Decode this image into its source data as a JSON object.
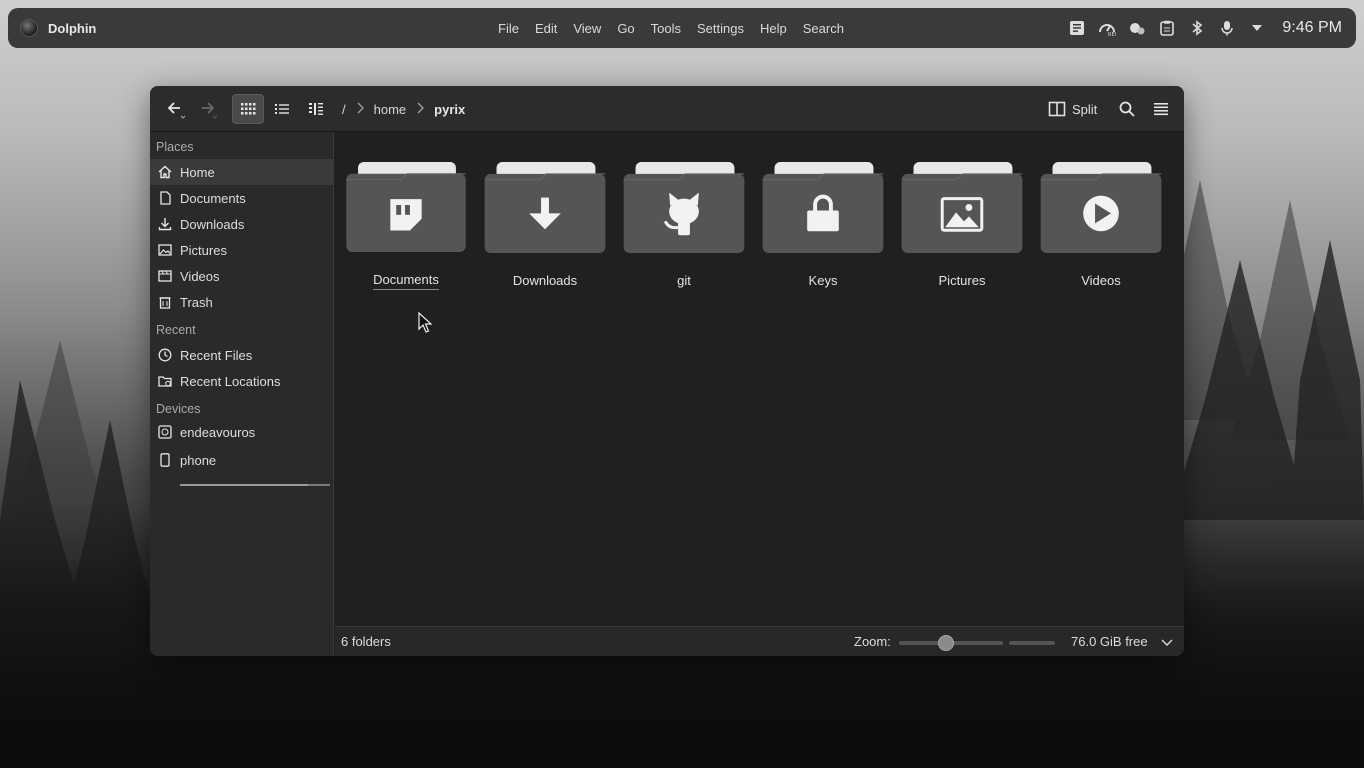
{
  "topbar": {
    "app_name": "Dolphin",
    "menu": [
      "File",
      "Edit",
      "View",
      "Go",
      "Tools",
      "Settings",
      "Help",
      "Search"
    ],
    "tray_icons": [
      "notes-icon",
      "speedometer-icon",
      "chat-icon",
      "clipboard-icon",
      "bluetooth-icon",
      "microphone-icon",
      "caret-down-icon"
    ],
    "clock": "9:46 PM"
  },
  "toolbar": {
    "breadcrumbs": [
      "/",
      "home",
      "pyrix"
    ],
    "split_label": "Split"
  },
  "sidebar": {
    "sections": {
      "places": "Places",
      "recent": "Recent",
      "devices": "Devices"
    },
    "places": [
      {
        "label": "Home",
        "icon": "home-icon",
        "selected": true
      },
      {
        "label": "Documents",
        "icon": "document-icon"
      },
      {
        "label": "Downloads",
        "icon": "download-icon"
      },
      {
        "label": "Pictures",
        "icon": "picture-icon"
      },
      {
        "label": "Videos",
        "icon": "video-icon"
      },
      {
        "label": "Trash",
        "icon": "trash-icon"
      }
    ],
    "recent": [
      {
        "label": "Recent Files",
        "icon": "clock-icon"
      },
      {
        "label": "Recent Locations",
        "icon": "folder-clock-icon"
      }
    ],
    "devices": [
      {
        "label": "endeavouros",
        "icon": "drive-icon",
        "usage": 0.85
      },
      {
        "label": "phone",
        "icon": "phone-icon"
      }
    ]
  },
  "folders": [
    {
      "name": "Documents",
      "emblem": "quote-icon"
    },
    {
      "name": "Downloads",
      "emblem": "download-arrow-icon"
    },
    {
      "name": "git",
      "emblem": "github-icon"
    },
    {
      "name": "Keys",
      "emblem": "lock-icon"
    },
    {
      "name": "Pictures",
      "emblem": "image-icon"
    },
    {
      "name": "Videos",
      "emblem": "play-icon"
    }
  ],
  "status": {
    "count": "6 folders",
    "zoom_label": "Zoom:",
    "zoom_level": 0.45,
    "free": "76.0 GiB free"
  }
}
